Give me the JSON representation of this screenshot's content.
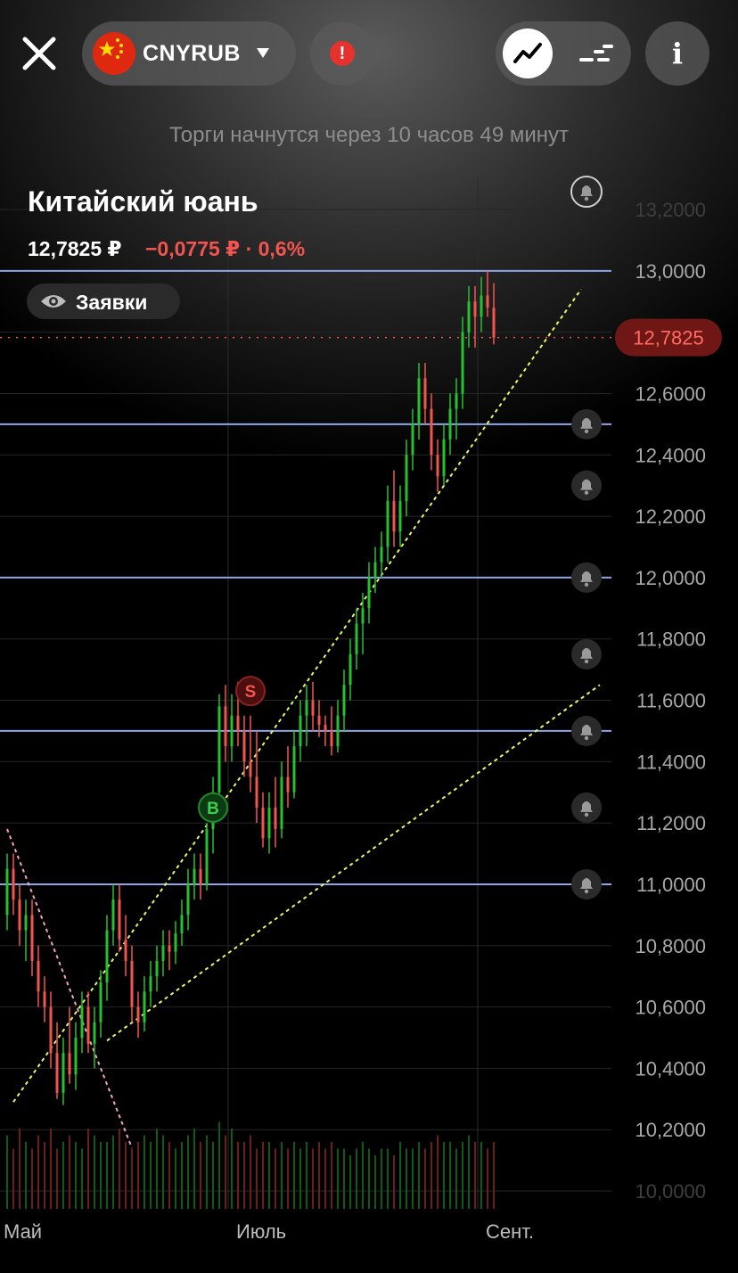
{
  "header": {
    "ticker": "CNYRUB",
    "status": "Торги начнутся через 10 часов 49 минут"
  },
  "instrument": {
    "name": "Китайский юань",
    "price": "12,7825 ₽",
    "change": "−0,0775 ₽ · 0,6%"
  },
  "orders_button": {
    "label": "Заявки"
  },
  "colors": {
    "up": "#25c12f",
    "down": "#f2554f",
    "level_line": "#8ea6e8",
    "trend_line": "#e8f56a",
    "price_tag": "#6f1714"
  },
  "chart_data": {
    "type": "candlestick",
    "y_ticks": [
      "13,2000",
      "13,0000",
      "12,8000",
      "12,6000",
      "12,4000",
      "12,2000",
      "12,0000",
      "11,8000",
      "11,6000",
      "11,4000",
      "11,2000",
      "11,0000",
      "10,8000",
      "10,6000",
      "10,4000",
      "10,2000",
      "10,0000"
    ],
    "x_ticks": [
      "Май",
      "Июль",
      "Сент."
    ],
    "ylim": [
      10.0,
      13.2
    ],
    "current_price": "12,7825",
    "current_value": 12.7825,
    "horizontal_levels": [
      13.0,
      12.5,
      12.0,
      11.5,
      11.0
    ],
    "alert_levels": [
      13.2,
      12.5,
      12.3,
      12.0,
      11.75,
      11.5,
      11.25,
      11.0
    ],
    "trend_lines": [
      {
        "from": [
          1,
          10.29
        ],
        "to": [
          92,
          12.94
        ],
        "style": "dotted"
      },
      {
        "from": [
          16,
          10.49
        ],
        "to": [
          95,
          11.65
        ],
        "style": "dotted"
      },
      {
        "from": [
          0,
          11.18
        ],
        "to": [
          20,
          10.14
        ],
        "style": "dotted",
        "color": "pink"
      }
    ],
    "markers": [
      {
        "label": "B",
        "x": 33,
        "value": 11.25,
        "color": "green"
      },
      {
        "label": "S",
        "x": 39,
        "value": 11.63,
        "color": "red"
      }
    ],
    "candles": [
      [
        0,
        10.9,
        11.1,
        10.85,
        11.05
      ],
      [
        1,
        11.05,
        11.1,
        10.9,
        10.95
      ],
      [
        2,
        10.95,
        11.0,
        10.8,
        10.85
      ],
      [
        3,
        10.85,
        10.95,
        10.75,
        10.9
      ],
      [
        4,
        10.9,
        10.95,
        10.7,
        10.75
      ],
      [
        5,
        10.75,
        10.8,
        10.6,
        10.65
      ],
      [
        6,
        10.65,
        10.7,
        10.55,
        10.6
      ],
      [
        7,
        10.6,
        10.65,
        10.4,
        10.45
      ],
      [
        8,
        10.45,
        10.55,
        10.3,
        10.32
      ],
      [
        9,
        10.32,
        10.5,
        10.28,
        10.45
      ],
      [
        10,
        10.45,
        10.6,
        10.35,
        10.38
      ],
      [
        11,
        10.38,
        10.55,
        10.33,
        10.5
      ],
      [
        12,
        10.5,
        10.65,
        10.45,
        10.6
      ],
      [
        13,
        10.6,
        10.65,
        10.45,
        10.48
      ],
      [
        14,
        10.48,
        10.6,
        10.4,
        10.55
      ],
      [
        15,
        10.55,
        10.72,
        10.5,
        10.68
      ],
      [
        16,
        10.68,
        10.9,
        10.62,
        10.85
      ],
      [
        17,
        10.85,
        11.0,
        10.8,
        10.95
      ],
      [
        18,
        10.95,
        11.0,
        10.78,
        10.82
      ],
      [
        19,
        10.82,
        10.9,
        10.7,
        10.75
      ],
      [
        20,
        10.75,
        10.8,
        10.55,
        10.6
      ],
      [
        21,
        10.6,
        10.65,
        10.5,
        10.55
      ],
      [
        22,
        10.55,
        10.7,
        10.52,
        10.65
      ],
      [
        23,
        10.65,
        10.75,
        10.6,
        10.7
      ],
      [
        24,
        10.7,
        10.8,
        10.65,
        10.75
      ],
      [
        25,
        10.75,
        10.85,
        10.7,
        10.8
      ],
      [
        26,
        10.8,
        10.85,
        10.72,
        10.78
      ],
      [
        27,
        10.78,
        10.88,
        10.74,
        10.84
      ],
      [
        28,
        10.84,
        10.95,
        10.8,
        10.9
      ],
      [
        29,
        10.9,
        11.05,
        10.85,
        11.0
      ],
      [
        30,
        11.0,
        11.1,
        10.95,
        11.05
      ],
      [
        31,
        11.05,
        11.1,
        10.95,
        11.0
      ],
      [
        32,
        11.0,
        11.2,
        10.98,
        11.18
      ],
      [
        33,
        11.18,
        11.35,
        11.1,
        11.3
      ],
      [
        34,
        11.3,
        11.62,
        11.28,
        11.58
      ],
      [
        35,
        11.58,
        11.65,
        11.4,
        11.45
      ],
      [
        36,
        11.45,
        11.62,
        11.4,
        11.55
      ],
      [
        37,
        11.55,
        11.66,
        11.45,
        11.5
      ],
      [
        38,
        11.5,
        11.55,
        11.35,
        11.4
      ],
      [
        39,
        11.4,
        11.55,
        11.3,
        11.35
      ],
      [
        40,
        11.35,
        11.5,
        11.2,
        11.25
      ],
      [
        41,
        11.25,
        11.3,
        11.12,
        11.15
      ],
      [
        42,
        11.15,
        11.3,
        11.1,
        11.25
      ],
      [
        43,
        11.25,
        11.35,
        11.12,
        11.18
      ],
      [
        44,
        11.18,
        11.4,
        11.15,
        11.35
      ],
      [
        45,
        11.35,
        11.45,
        11.25,
        11.3
      ],
      [
        46,
        11.3,
        11.5,
        11.28,
        11.45
      ],
      [
        47,
        11.45,
        11.6,
        11.4,
        11.55
      ],
      [
        48,
        11.55,
        11.65,
        11.45,
        11.6
      ],
      [
        49,
        11.6,
        11.66,
        11.5,
        11.55
      ],
      [
        50,
        11.55,
        11.6,
        11.48,
        11.52
      ],
      [
        51,
        11.52,
        11.55,
        11.45,
        11.5
      ],
      [
        52,
        11.5,
        11.58,
        11.42,
        11.45
      ],
      [
        53,
        11.45,
        11.6,
        11.43,
        11.55
      ],
      [
        54,
        11.55,
        11.7,
        11.5,
        11.65
      ],
      [
        55,
        11.65,
        11.8,
        11.6,
        11.75
      ],
      [
        56,
        11.75,
        11.9,
        11.7,
        11.85
      ],
      [
        57,
        11.85,
        11.95,
        11.75,
        11.9
      ],
      [
        58,
        11.9,
        12.05,
        11.85,
        12.0
      ],
      [
        59,
        12.0,
        12.1,
        11.95,
        12.05
      ],
      [
        60,
        12.05,
        12.15,
        12.0,
        12.1
      ],
      [
        61,
        12.1,
        12.3,
        12.05,
        12.25
      ],
      [
        62,
        12.25,
        12.35,
        12.1,
        12.15
      ],
      [
        63,
        12.15,
        12.3,
        12.1,
        12.25
      ],
      [
        64,
        12.25,
        12.45,
        12.2,
        12.4
      ],
      [
        65,
        12.4,
        12.55,
        12.35,
        12.5
      ],
      [
        66,
        12.5,
        12.7,
        12.45,
        12.65
      ],
      [
        67,
        12.65,
        12.7,
        12.5,
        12.55
      ],
      [
        68,
        12.55,
        12.6,
        12.35,
        12.4
      ],
      [
        69,
        12.4,
        12.45,
        12.28,
        12.33
      ],
      [
        70,
        12.33,
        12.5,
        12.3,
        12.45
      ],
      [
        71,
        12.45,
        12.6,
        12.4,
        12.55
      ],
      [
        72,
        12.55,
        12.65,
        12.45,
        12.6
      ],
      [
        73,
        12.6,
        12.85,
        12.55,
        12.8
      ],
      [
        74,
        12.8,
        12.95,
        12.75,
        12.9
      ],
      [
        75,
        12.9,
        12.95,
        12.75,
        12.85
      ],
      [
        76,
        12.85,
        12.98,
        12.8,
        12.92
      ],
      [
        77,
        12.92,
        13.0,
        12.85,
        12.88
      ],
      [
        78,
        12.88,
        12.96,
        12.76,
        12.7825
      ]
    ],
    "volumes": [
      0.55,
      0.45,
      0.6,
      0.5,
      0.45,
      0.55,
      0.5,
      0.6,
      0.45,
      0.5,
      0.55,
      0.5,
      0.45,
      0.6,
      0.55,
      0.5,
      0.5,
      0.55,
      0.6,
      0.5,
      0.45,
      0.5,
      0.55,
      0.5,
      0.6,
      0.55,
      0.5,
      0.45,
      0.5,
      0.55,
      0.6,
      0.5,
      0.55,
      0.5,
      0.65,
      0.55,
      0.6,
      0.5,
      0.5,
      0.55,
      0.45,
      0.5,
      0.5,
      0.45,
      0.5,
      0.45,
      0.5,
      0.45,
      0.5,
      0.45,
      0.5,
      0.45,
      0.5,
      0.45,
      0.45,
      0.4,
      0.45,
      0.5,
      0.45,
      0.4,
      0.45,
      0.45,
      0.4,
      0.5,
      0.45,
      0.45,
      0.5,
      0.45,
      0.5,
      0.55,
      0.5,
      0.5,
      0.45,
      0.5,
      0.55,
      0.5,
      0.5,
      0.45,
      0.5
    ]
  }
}
